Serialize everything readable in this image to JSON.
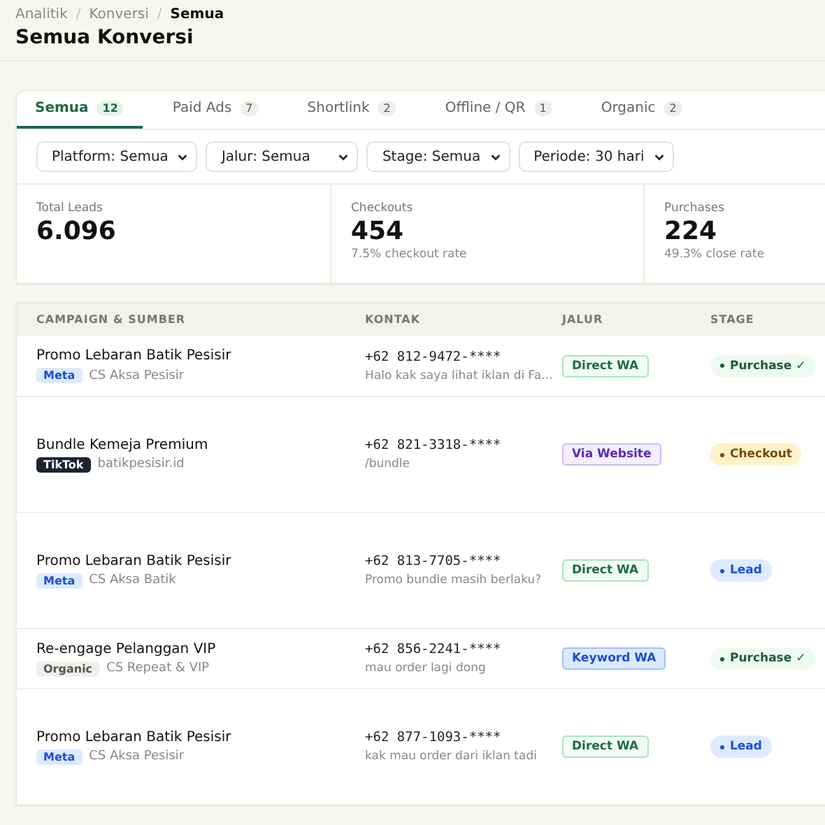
{
  "breadcrumb_separator": "/",
  "breadcrumb": [
    {
      "label": "Analitik",
      "current": false
    },
    {
      "label": "Konversi",
      "current": false
    },
    {
      "label": "Semua",
      "current": true
    }
  ],
  "title": "Semua Konversi",
  "tabs": [
    {
      "label": "Semua",
      "count": "12",
      "selected": true
    },
    {
      "label": "Paid Ads",
      "count": "7",
      "selected": false
    },
    {
      "label": "Shortlink",
      "count": "2",
      "selected": false
    },
    {
      "label": "Offline / QR",
      "count": "1",
      "selected": false
    },
    {
      "label": "Organic",
      "count": "2",
      "selected": false
    }
  ],
  "filters": [
    {
      "value": "Platform: Semua"
    },
    {
      "value": "Jalur: Semua"
    },
    {
      "value": "Stage: Semua"
    },
    {
      "value": "Periode: 30 hari"
    }
  ],
  "stats": [
    {
      "label": "Total Leads",
      "value": "6.096"
    },
    {
      "label": "Checkouts",
      "value": "454",
      "note": "7.5% checkout rate"
    },
    {
      "label": "Purchases",
      "value": "224",
      "note": "49.3% close rate"
    }
  ],
  "table": {
    "columns": [
      "CAMPAIGN & SUMBER",
      "KONTAK",
      "JALUR",
      "STAGE"
    ],
    "rows": [
      {
        "campaign": "Promo Lebaran Batik Pesisir",
        "platform": {
          "label": "Meta",
          "kind": "meta"
        },
        "source": "CS Aksa Pesisir",
        "phone": "+62 812-9472-****",
        "message": "Halo kak saya lihat iklan di Fa...",
        "route": {
          "label": "Direct WA",
          "kind": "direct"
        },
        "stage": {
          "label": "Purchase ✓",
          "kind": "purchase"
        }
      },
      {
        "campaign": "Bundle Kemeja Premium",
        "platform": {
          "label": "TikTok",
          "kind": "tiktok"
        },
        "source": "batikpesisir.id",
        "phone": "+62 821-3318-****",
        "message": "/bundle",
        "route": {
          "label": "Via Website",
          "kind": "website"
        },
        "stage": {
          "label": "Checkout",
          "kind": "checkout"
        }
      },
      {
        "campaign": "Promo Lebaran Batik Pesisir",
        "platform": {
          "label": "Meta",
          "kind": "meta"
        },
        "source": "CS Aksa Batik",
        "phone": "+62 813-7705-****",
        "message": "Promo bundle masih berlaku?",
        "route": {
          "label": "Direct WA",
          "kind": "direct"
        },
        "stage": {
          "label": "Lead",
          "kind": "lead"
        }
      },
      {
        "campaign": "Re-engage Pelanggan VIP",
        "platform": {
          "label": "Organic",
          "kind": "organic"
        },
        "source": "CS Repeat & VIP",
        "phone": "+62 856-2241-****",
        "message": "mau order lagi dong",
        "route": {
          "label": "Keyword WA",
          "kind": "keyword"
        },
        "stage": {
          "label": "Purchase ✓",
          "kind": "purchase"
        }
      },
      {
        "campaign": "Promo Lebaran Batik Pesisir",
        "platform": {
          "label": "Meta",
          "kind": "meta"
        },
        "source": "CS Aksa Pesisir",
        "phone": "+62 877-1093-****",
        "message": "kak mau order dari iklan tadi",
        "route": {
          "label": "Direct WA",
          "kind": "direct"
        },
        "stage": {
          "label": "Lead",
          "kind": "lead"
        }
      }
    ]
  }
}
